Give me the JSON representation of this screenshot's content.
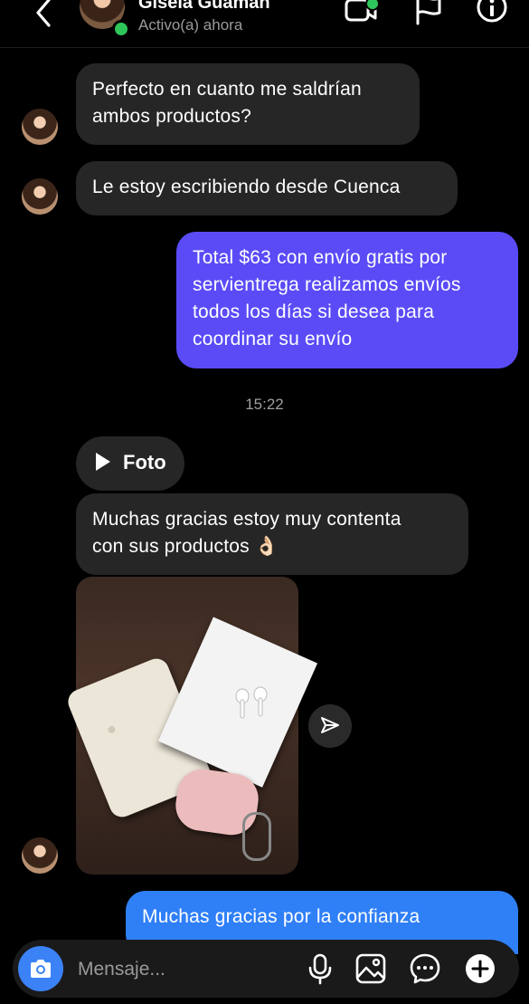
{
  "header": {
    "contact_name": "Gisela Guaman",
    "status": "Activo(a) ahora",
    "icons": [
      "back-icon",
      "video-call-icon",
      "flag-icon",
      "info-icon"
    ]
  },
  "messages": [
    {
      "direction": "in",
      "text_lines": [
        "Perfecto en cuanto me saldrían",
        "ambos productos?"
      ]
    },
    {
      "direction": "in",
      "text_lines": [
        "Le estoy escribiendo desde Cuenca"
      ]
    },
    {
      "direction": "out",
      "text_lines": [
        "Total $63 con envío gratis por",
        "servientrega realizamos envíos",
        "todos los días si desea para",
        "coordinar su envío"
      ]
    },
    {
      "direction": "in",
      "text_lines": [
        "Muchas gracias estoy muy contenta",
        "con sus productos 👌🏻"
      ]
    },
    {
      "direction": "out",
      "text_lines": [
        "Muchas gracias por la confianza"
      ]
    }
  ],
  "timestamp": "15:22",
  "foto_label": "Foto",
  "composer": {
    "placeholder": "Mensaje...",
    "icons": [
      "camera-icon",
      "microphone-icon",
      "gallery-icon",
      "sticker-icon",
      "add-icon"
    ]
  },
  "colors": {
    "background": "#000000",
    "incoming_bubble": "#262626",
    "outgoing_purple": "#5a4bf7",
    "outgoing_blue": "#2f7ff7",
    "online": "#2ec65a",
    "camera_button": "#3b82f6"
  }
}
